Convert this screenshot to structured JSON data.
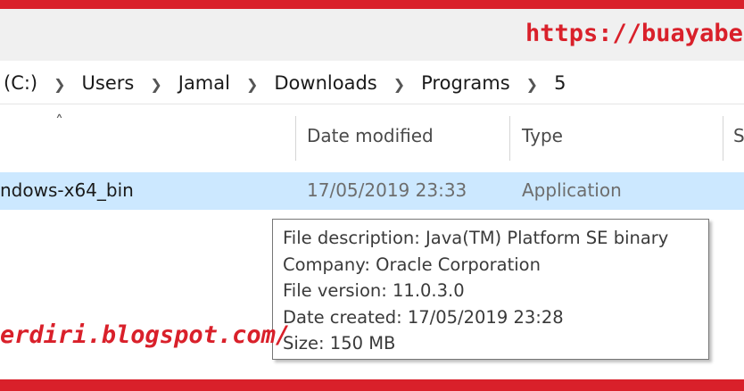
{
  "watermark": {
    "top_text": "https://buayaberd",
    "bottom_text": "erdiri.blogspot.com/",
    "color": "#d9202a"
  },
  "breadcrumb": {
    "items": [
      "(C:)",
      "Users",
      "Jamal",
      "Downloads",
      "Programs",
      "5"
    ],
    "separator_icon": "chevron-right-icon"
  },
  "columns": {
    "date_modified": "Date modified",
    "type": "Type",
    "size_partial": "S"
  },
  "file_row": {
    "name": "ndows-x64_bin",
    "date_modified": "17/05/2019 23:33",
    "type": "Application",
    "selected_color": "#cce8ff"
  },
  "tooltip": {
    "lines": [
      "File description: Java(TM) Platform SE binary",
      "Company: Oracle Corporation",
      "File version: 11.0.3.0",
      "Date created: 17/05/2019 23:28",
      "Size: 150 MB"
    ]
  },
  "accent_color": "#d9202a"
}
